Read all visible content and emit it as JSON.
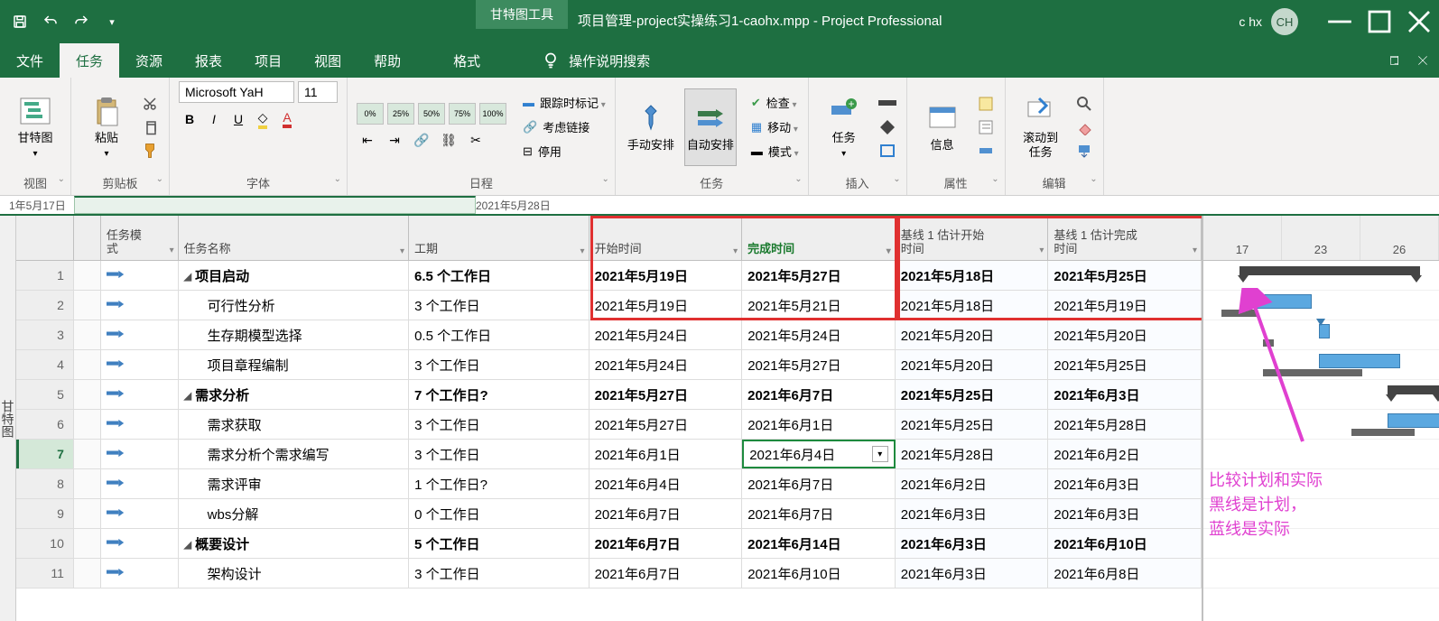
{
  "titlebar": {
    "context_tab": "甘特图工具",
    "title": "项目管理-project实操练习1-caohx.mpp  -  Project Professional",
    "user": "c hx",
    "avatar": "CH"
  },
  "menu": {
    "file": "文件",
    "task": "任务",
    "resource": "资源",
    "report": "报表",
    "project": "项目",
    "view": "视图",
    "help": "帮助",
    "format": "格式",
    "tellme": "操作说明搜索"
  },
  "ribbon": {
    "view_group": "视图",
    "gantt": "甘特图",
    "clipboard_group": "剪贴板",
    "paste": "粘贴",
    "font_group": "字体",
    "font_name": "Microsoft YaH",
    "font_size": "11",
    "schedule_group": "日程",
    "pct": [
      "0%",
      "25%",
      "50%",
      "75%",
      "100%"
    ],
    "track": "跟踪时标记",
    "respect": "考虑链接",
    "disable": "停用",
    "tasks_group": "任务",
    "manual": "手动安排",
    "auto": "自动安排",
    "check": "检查",
    "move": "移动",
    "mode": "模式",
    "insert_group": "插入",
    "task_btn": "任务",
    "props_group": "属性",
    "info": "信息",
    "edit_group": "编辑",
    "scroll": "滚动到\n任务"
  },
  "timeline": {
    "t1": "1年5月17日",
    "t2": "2021年5月28日"
  },
  "vtab": "甘特图",
  "headers": {
    "mode": "任务模\n式",
    "name": "任务名称",
    "dur": "工期",
    "start": "开始时间",
    "finish": "完成时间",
    "bl1": "基线 1 估计开始\n时间",
    "bl2": "基线 1 估计完成\n时间"
  },
  "gantt_days": [
    "17",
    "23",
    "26"
  ],
  "rows": [
    {
      "n": "1",
      "bold": true,
      "outline": true,
      "indent": 0,
      "name": "项目启动",
      "dur": "6.5 个工作日",
      "start": "2021年5月19日",
      "finish": "2021年5月27日",
      "bl1": "2021年5月18日",
      "bl2": "2021年5月25日"
    },
    {
      "n": "2",
      "bold": false,
      "indent": 1,
      "name": "可行性分析",
      "dur": "3 个工作日",
      "start": "2021年5月19日",
      "finish": "2021年5月21日",
      "bl1": "2021年5月18日",
      "bl2": "2021年5月19日"
    },
    {
      "n": "3",
      "bold": false,
      "indent": 1,
      "name": "生存期模型选择",
      "dur": "0.5 个工作日",
      "start": "2021年5月24日",
      "finish": "2021年5月24日",
      "bl1": "2021年5月20日",
      "bl2": "2021年5月20日"
    },
    {
      "n": "4",
      "bold": false,
      "indent": 1,
      "name": "项目章程编制",
      "dur": "3 个工作日",
      "start": "2021年5月24日",
      "finish": "2021年5月27日",
      "bl1": "2021年5月20日",
      "bl2": "2021年5月25日"
    },
    {
      "n": "5",
      "bold": true,
      "outline": true,
      "indent": 0,
      "name": "需求分析",
      "dur": "7 个工作日?",
      "start": "2021年5月27日",
      "finish": "2021年6月7日",
      "bl1": "2021年5月25日",
      "bl2": "2021年6月3日"
    },
    {
      "n": "6",
      "bold": false,
      "indent": 1,
      "name": "需求获取",
      "dur": "3 个工作日",
      "start": "2021年5月27日",
      "finish": "2021年6月1日",
      "bl1": "2021年5月25日",
      "bl2": "2021年5月28日"
    },
    {
      "n": "7",
      "bold": false,
      "indent": 1,
      "selected": true,
      "editing": true,
      "name": "需求分析个需求编写",
      "dur": "3 个工作日",
      "start": "2021年6月1日",
      "finish": "2021年6月4日",
      "bl1": "2021年5月28日",
      "bl2": "2021年6月2日"
    },
    {
      "n": "8",
      "bold": false,
      "indent": 1,
      "name": "需求评审",
      "dur": "1 个工作日?",
      "start": "2021年6月4日",
      "finish": "2021年6月7日",
      "bl1": "2021年6月2日",
      "bl2": "2021年6月3日"
    },
    {
      "n": "9",
      "bold": false,
      "indent": 1,
      "name": "wbs分解",
      "dur": "0 个工作日",
      "start": "2021年6月7日",
      "finish": "2021年6月7日",
      "bl1": "2021年6月3日",
      "bl2": "2021年6月3日"
    },
    {
      "n": "10",
      "bold": true,
      "outline": true,
      "indent": 0,
      "name": "概要设计",
      "dur": "5 个工作日",
      "start": "2021年6月7日",
      "finish": "2021年6月14日",
      "bl1": "2021年6月3日",
      "bl2": "2021年6月10日"
    },
    {
      "n": "11",
      "bold": false,
      "indent": 1,
      "name": "架构设计",
      "dur": "3 个工作日",
      "start": "2021年6月7日",
      "finish": "2021年6月10日",
      "bl1": "2021年6月3日",
      "bl2": "2021年6月8日"
    }
  ],
  "annotation": {
    "l1": "比较计划和实际",
    "l2": "黑线是计划，",
    "l3": "蓝线是实际"
  }
}
